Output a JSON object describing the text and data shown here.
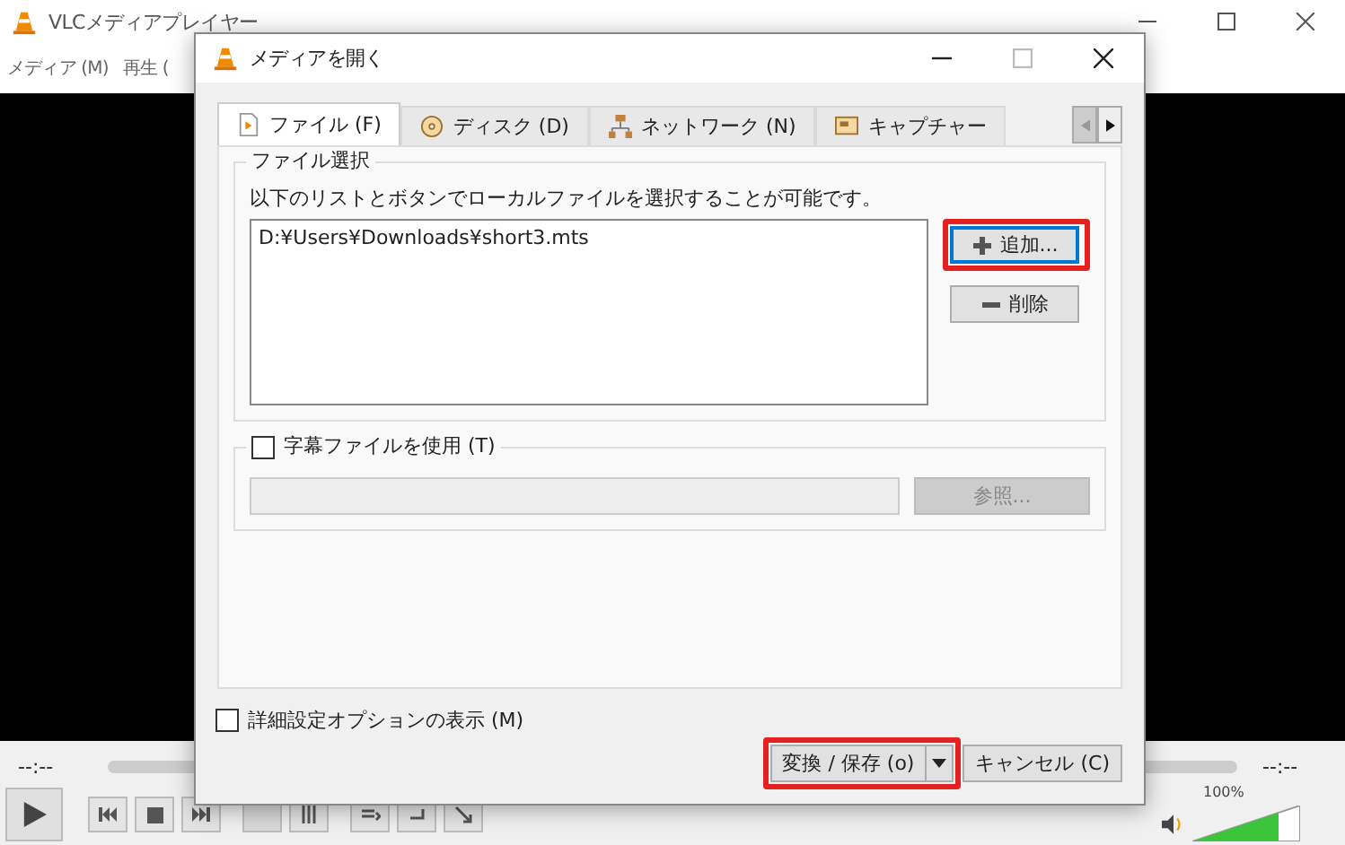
{
  "main_window": {
    "title": "VLCメディアプレイヤー",
    "menu": [
      "メディア (M)",
      "再生 ("
    ],
    "elapsed": "--:--",
    "remaining": "--:--",
    "volume": {
      "reading": "100%",
      "level": 0.8
    }
  },
  "dialog": {
    "title": "メディアを開く",
    "tabs": [
      {
        "label": "ファイル (F)",
        "selected": true
      },
      {
        "label": "ディスク (D)",
        "selected": false
      },
      {
        "label": "ネットワーク (N)",
        "selected": false
      },
      {
        "label": "キャプチャー",
        "selected": false
      }
    ],
    "file_group": {
      "title": "ファイル選択",
      "description": "以下のリストとボタンでローカルファイルを選択することが可能です。",
      "files": [
        "D:¥Users¥Downloads¥short3.mts"
      ],
      "buttons": [
        {
          "label": "追加...",
          "kind": "add",
          "highlighted": true,
          "focused": true
        },
        {
          "label": "削除",
          "kind": "remove",
          "highlighted": false,
          "focused": false
        }
      ]
    },
    "subtitle": {
      "label": "字幕ファイルを使用 (T)",
      "checked": false,
      "browse": "参照..."
    },
    "advanced": {
      "label": "詳細設定オプションの表示 (M)",
      "checked": false
    },
    "convert_button": {
      "label": "変換 / 保存 (o)",
      "highlighted": true
    },
    "cancel_button": "キャンセル (C)"
  }
}
